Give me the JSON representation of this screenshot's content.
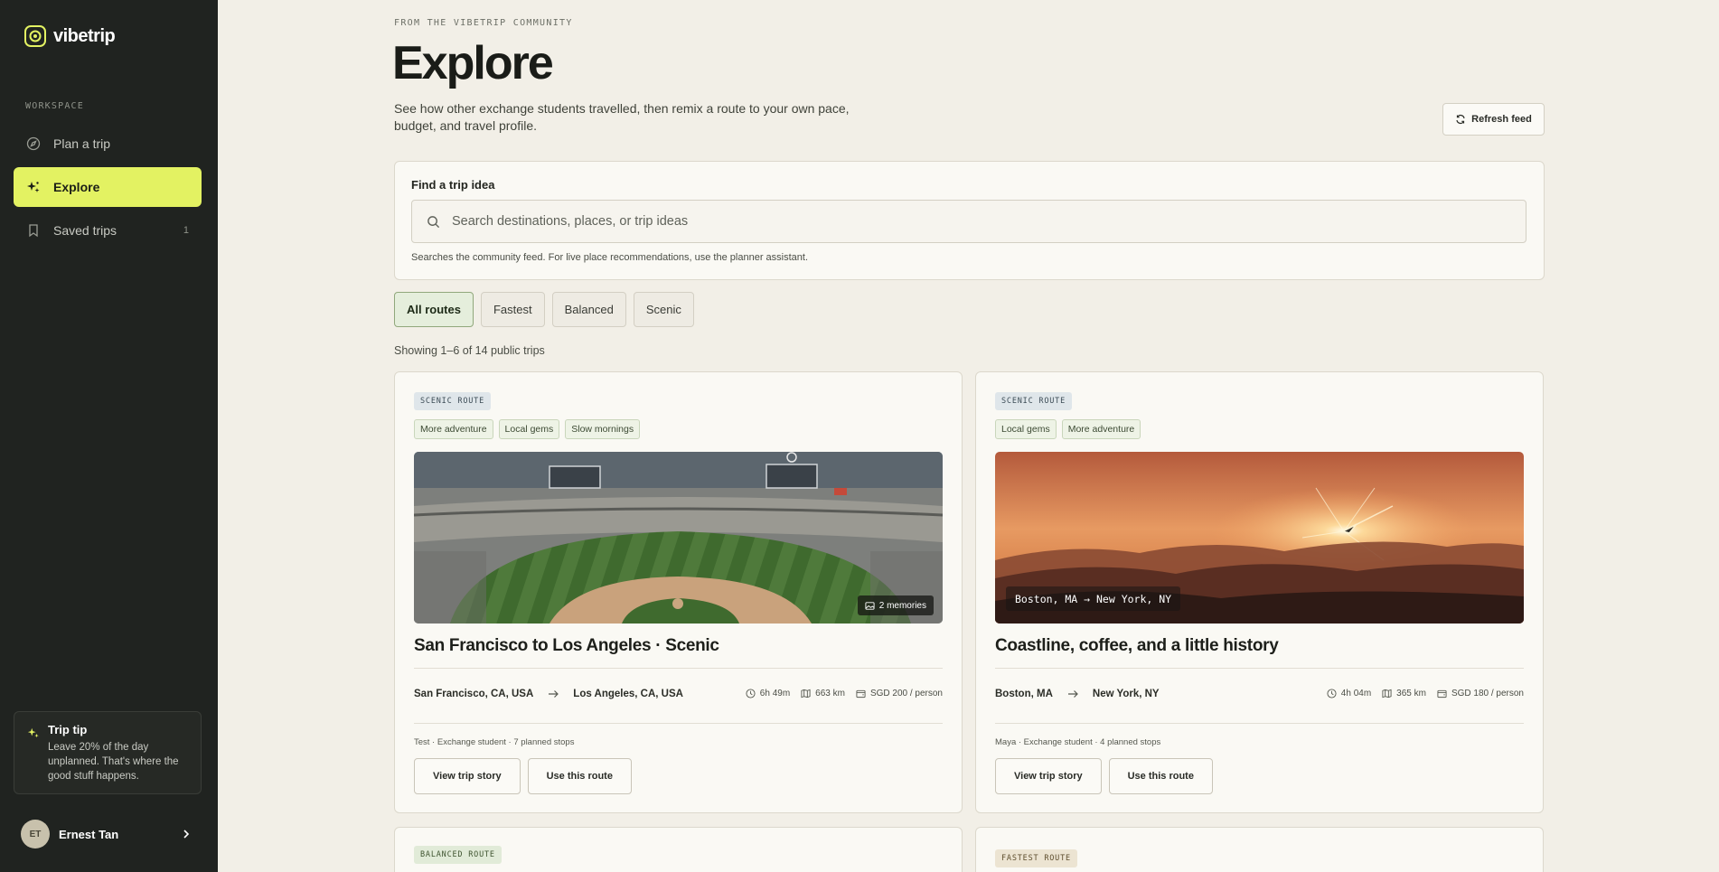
{
  "app": {
    "name": "vibetrip",
    "brand_color": "#e3f262"
  },
  "sidebar": {
    "section_label": "WORKSPACE",
    "items": [
      {
        "label": "Plan a trip",
        "icon": "compass-icon",
        "active": false
      },
      {
        "label": "Explore",
        "icon": "sparkle-icon",
        "active": true
      },
      {
        "label": "Saved trips",
        "icon": "bookmark-icon",
        "active": false,
        "count": "1"
      }
    ],
    "tip": {
      "title": "Trip tip",
      "text": "Leave 20% of the day unplanned. That's where the good stuff happens."
    },
    "user": {
      "initials": "ET",
      "name": "Ernest Tan"
    }
  },
  "header": {
    "eyebrow": "FROM THE VIBETRIP COMMUNITY",
    "title": "Explore",
    "subtitle": "See how other exchange students travelled, then remix a route to your own pace, budget, and travel profile.",
    "refresh_label": "Refresh feed"
  },
  "search": {
    "label": "Find a trip idea",
    "placeholder": "Search destinations, places, or trip ideas",
    "value": "",
    "help": "Searches the community feed. For live place recommendations, use the planner assistant."
  },
  "filters": [
    {
      "label": "All routes",
      "active": true
    },
    {
      "label": "Fastest",
      "active": false
    },
    {
      "label": "Balanced",
      "active": false
    },
    {
      "label": "Scenic",
      "active": false
    }
  ],
  "results_count": "Showing 1–6 of 14 public trips",
  "cards": [
    {
      "badge": "SCENIC ROUTE",
      "tags": [
        "More adventure",
        "Local gems",
        "Slow mornings"
      ],
      "memories": "2 memories",
      "title": "San Francisco to Los Angeles · Scenic",
      "from": "San Francisco, CA, USA",
      "to": "Los Angeles, CA, USA",
      "duration": "6h 49m",
      "distance": "663 km",
      "cost": "SGD 200 / person",
      "meta": "Test · Exchange student · 7 planned stops",
      "primary_action": "View trip story",
      "secondary_action": "Use this route"
    },
    {
      "badge": "SCENIC ROUTE",
      "tags": [
        "Local gems",
        "More adventure"
      ],
      "overlay": "Boston, MA → New York, NY",
      "title": "Coastline, coffee, and a little history",
      "from": "Boston, MA",
      "to": "New York, NY",
      "duration": "4h 04m",
      "distance": "365 km",
      "cost": "SGD 180 / person",
      "meta": "Maya · Exchange student · 4 planned stops",
      "primary_action": "View trip story",
      "secondary_action": "Use this route"
    },
    {
      "badge": "BALANCED ROUTE"
    },
    {
      "badge": "FASTEST ROUTE"
    }
  ]
}
